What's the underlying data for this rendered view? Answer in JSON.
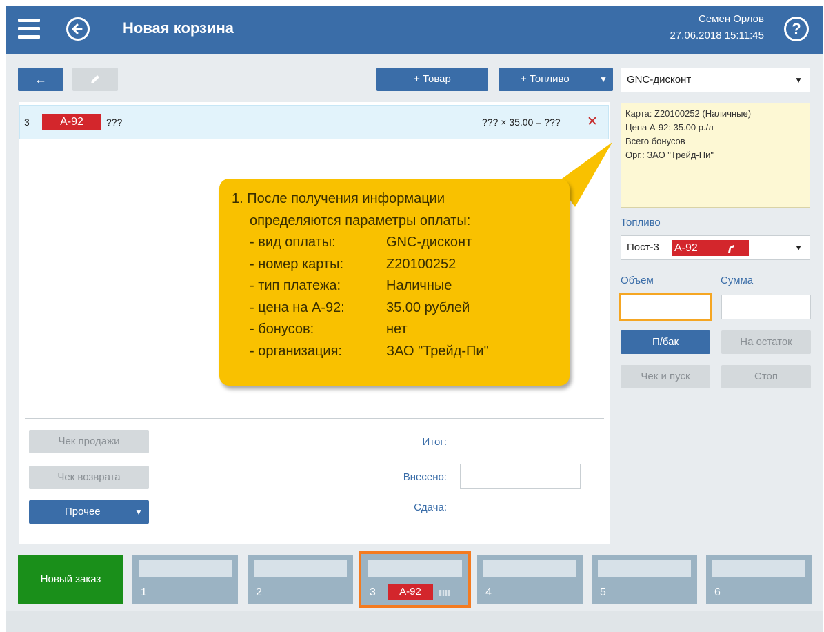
{
  "header": {
    "title": "Новая корзина",
    "user_name": "Семен Орлов",
    "datetime": "27.06.2018 15:11:45",
    "help_label": "?"
  },
  "toolbar": {
    "back_arrow": "←",
    "edit_icon": "pencil-icon",
    "add_product_label": "+ Товар",
    "add_fuel_label": "+ Топливо",
    "add_fuel_caret": "▼"
  },
  "order_line": {
    "index": "3",
    "fuel": "А-92",
    "qty": "???",
    "formula": "??? × 35.00 = ???",
    "remove": "✕"
  },
  "payment": {
    "selected": "GNC-дисконт",
    "caret": "▼",
    "info": [
      "Карта: Z20100252 (Наличные)",
      "Цена А-92: 35.00 р./л",
      "Всего бонусов",
      "Орг.: ЗАО \"Трейд-Пи\""
    ]
  },
  "fuel_panel": {
    "label": "Топливо",
    "pump": "Пост-3",
    "fuel": "А-92",
    "caret": "▼",
    "volume_label": "Объем",
    "sum_label": "Сумма",
    "volume_value": "",
    "sum_value": "",
    "full_tank_label": "П/бак",
    "remainder_label": "На остаток",
    "check_start_label": "Чек и пуск",
    "stop_label": "Стоп"
  },
  "callout": {
    "heading": "1. После получения информации",
    "subheading": "определяются параметры оплаты:",
    "rows": [
      {
        "k": "- вид оплаты:",
        "v": "GNC-дисконт"
      },
      {
        "k": "- номер карты:",
        "v": "Z20100252"
      },
      {
        "k": "- тип платежа:",
        "v": "Наличные"
      },
      {
        "k": "- цена на А-92:",
        "v": "35.00 рублей"
      },
      {
        "k": "- бонусов:",
        "v": "нет"
      },
      {
        "k": "- организация:",
        "v": "ЗАО \"Трейд-Пи\""
      }
    ]
  },
  "summary": {
    "sale_check_label": "Чек продажи",
    "return_check_label": "Чек возврата",
    "other_label": "Прочее",
    "other_caret": "▼",
    "total_label": "Итог:",
    "paid_label": "Внесено:",
    "change_label": "Сдача:",
    "paid_value": ""
  },
  "orders": {
    "new_order_label": "Новый заказ",
    "tiles": [
      {
        "num": "1",
        "fuel": ""
      },
      {
        "num": "2",
        "fuel": ""
      },
      {
        "num": "3",
        "fuel": "А-92"
      },
      {
        "num": "4",
        "fuel": ""
      },
      {
        "num": "5",
        "fuel": ""
      },
      {
        "num": "6",
        "fuel": ""
      }
    ]
  },
  "colors": {
    "header_bg": "#3a6da8",
    "accent_orange": "#f47b20",
    "fuel_red": "#d3262c",
    "callout_yellow": "#f9c100",
    "new_order_green": "#1a8f1a"
  }
}
